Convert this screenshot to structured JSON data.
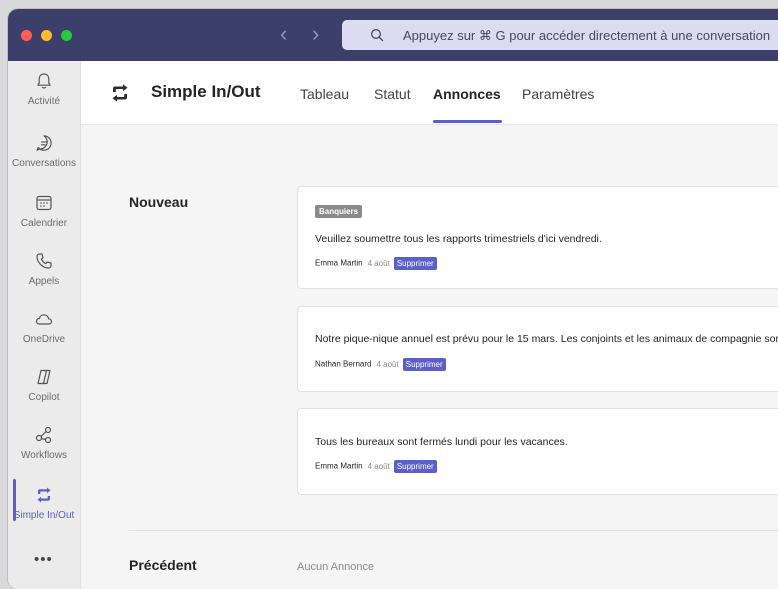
{
  "search": {
    "text": "Appuyez sur ⌘ G pour accéder directement à une conversation"
  },
  "rail": {
    "items": [
      {
        "label": "Activité",
        "icon": "bell-icon"
      },
      {
        "label": "Conversations",
        "icon": "chat-icon"
      },
      {
        "label": "Calendrier",
        "icon": "calendar-icon"
      },
      {
        "label": "Appels",
        "icon": "phone-icon"
      },
      {
        "label": "OneDrive",
        "icon": "cloud-icon"
      },
      {
        "label": "Copilot",
        "icon": "copilot-icon"
      },
      {
        "label": "Workflows",
        "icon": "workflow-icon"
      },
      {
        "label": "Simple In/Out",
        "icon": "app-icon"
      }
    ],
    "more": "•••"
  },
  "app": {
    "title": "Simple In/Out",
    "tabs": [
      {
        "label": "Tableau"
      },
      {
        "label": "Statut"
      },
      {
        "label": "Annonces",
        "active": true
      },
      {
        "label": "Paramètres"
      }
    ]
  },
  "sections": {
    "new_title": "Nouveau",
    "previous_title": "Précédent",
    "previous_empty": "Aucun Annonce"
  },
  "announcements": [
    {
      "badge": "Banquiers",
      "text": "Veuillez soumettre tous les rapports trimestriels d'ici vendredi.",
      "author": "Emma Martin",
      "date": "4 août",
      "delete_label": "Supprimer"
    },
    {
      "badge": "",
      "text": "Notre pique-nique annuel est prévu pour le 15 mars. Les conjoints et les animaux de compagnie sont les bienvenus.",
      "author": "Nathan Bernard",
      "date": "4 août",
      "delete_label": "Supprimer"
    },
    {
      "badge": "",
      "text": "Tous les bureaux sont fermés lundi pour les vacances.",
      "author": "Emma Martin",
      "date": "4 août",
      "delete_label": "Supprimer"
    }
  ],
  "colors": {
    "accent": "#5b5fc7",
    "titlebar": "#3c3f69"
  }
}
